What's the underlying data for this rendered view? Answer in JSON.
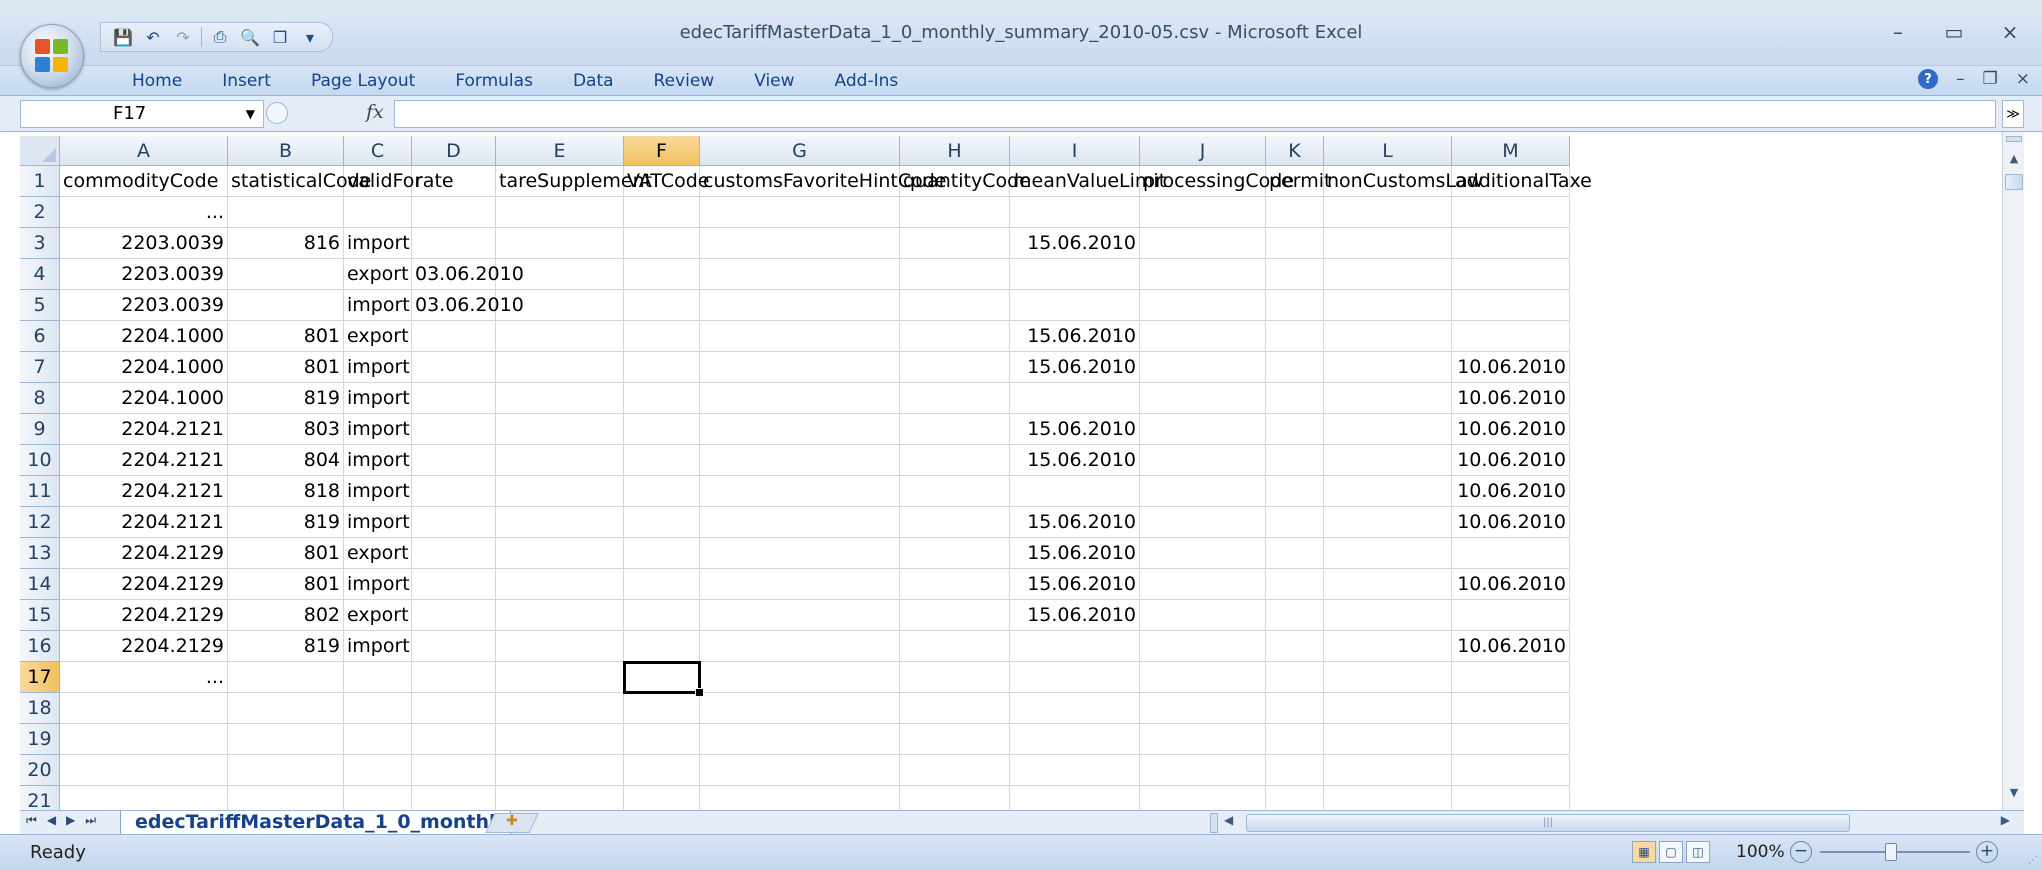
{
  "window": {
    "title": "edecTariffMasterData_1_0_monthly_summary_2010-05.csv - Microsoft Excel",
    "minimize_glyph": "–",
    "maximize_glyph": "▭",
    "close_glyph": "×"
  },
  "quick_access": {
    "icons": [
      "save-icon",
      "undo-icon",
      "redo-icon",
      "print-icon",
      "print-preview-icon",
      "window-icon"
    ],
    "customize_glyph": "▾"
  },
  "ribbon": {
    "tabs": [
      "Home",
      "Insert",
      "Page Layout",
      "Formulas",
      "Data",
      "Review",
      "View",
      "Add-Ins"
    ],
    "help_glyph": "?",
    "doc_min": "–",
    "doc_restore": "❐",
    "doc_close": "×"
  },
  "formula_bar": {
    "name_box": "F17",
    "fx_label": "fx",
    "formula": "",
    "expand_glyph": "≫"
  },
  "sheet": {
    "columns": [
      "A",
      "B",
      "C",
      "D",
      "E",
      "F",
      "G",
      "H",
      "I",
      "J",
      "K",
      "L",
      "M"
    ],
    "active_column": "F",
    "active_row": "17",
    "row_numbers": [
      "1",
      "2",
      "3",
      "4",
      "5",
      "6",
      "7",
      "8",
      "9",
      "10",
      "11",
      "12",
      "13",
      "14",
      "15",
      "16",
      "17",
      "18",
      "19",
      "20",
      "21"
    ],
    "rows": [
      [
        "commodityCode",
        "statisticalCode",
        "validFor",
        "rate",
        "tareSupplement",
        "VATCode",
        "customsFavoriteHintCode",
        "quantityCode",
        "meanValueLimit",
        "processingCode",
        "permit",
        "nonCustomsLaw",
        "additionalTaxe"
      ],
      [
        "...",
        "",
        "",
        "",
        "",
        "",
        "",
        "",
        "",
        "",
        "",
        "",
        ""
      ],
      [
        "2203.0039",
        "816",
        "import",
        "",
        "",
        "",
        "",
        "",
        "15.06.2010",
        "",
        "",
        "",
        ""
      ],
      [
        "2203.0039",
        "",
        "export",
        "03.06.2010",
        "",
        "",
        "",
        "",
        "",
        "",
        "",
        "",
        ""
      ],
      [
        "2203.0039",
        "",
        "import",
        "03.06.2010",
        "",
        "",
        "",
        "",
        "",
        "",
        "",
        "",
        ""
      ],
      [
        "2204.1000",
        "801",
        "export",
        "",
        "",
        "",
        "",
        "",
        "15.06.2010",
        "",
        "",
        "",
        ""
      ],
      [
        "2204.1000",
        "801",
        "import",
        "",
        "",
        "",
        "",
        "",
        "15.06.2010",
        "",
        "",
        "",
        "10.06.2010"
      ],
      [
        "2204.1000",
        "819",
        "import",
        "",
        "",
        "",
        "",
        "",
        "",
        "",
        "",
        "",
        "10.06.2010"
      ],
      [
        "2204.2121",
        "803",
        "import",
        "",
        "",
        "",
        "",
        "",
        "15.06.2010",
        "",
        "",
        "",
        "10.06.2010"
      ],
      [
        "2204.2121",
        "804",
        "import",
        "",
        "",
        "",
        "",
        "",
        "15.06.2010",
        "",
        "",
        "",
        "10.06.2010"
      ],
      [
        "2204.2121",
        "818",
        "import",
        "",
        "",
        "",
        "",
        "",
        "",
        "",
        "",
        "",
        "10.06.2010"
      ],
      [
        "2204.2121",
        "819",
        "import",
        "",
        "",
        "",
        "",
        "",
        "15.06.2010",
        "",
        "",
        "",
        "10.06.2010"
      ],
      [
        "2204.2129",
        "801",
        "export",
        "",
        "",
        "",
        "",
        "",
        "15.06.2010",
        "",
        "",
        "",
        ""
      ],
      [
        "2204.2129",
        "801",
        "import",
        "",
        "",
        "",
        "",
        "",
        "15.06.2010",
        "",
        "",
        "",
        "10.06.2010"
      ],
      [
        "2204.2129",
        "802",
        "export",
        "",
        "",
        "",
        "",
        "",
        "15.06.2010",
        "",
        "",
        "",
        ""
      ],
      [
        "2204.2129",
        "819",
        "import",
        "",
        "",
        "",
        "",
        "",
        "",
        "",
        "",
        "",
        "10.06.2010"
      ],
      [
        "...",
        "",
        "",
        "",
        "",
        "",
        "",
        "",
        "",
        "",
        "",
        "",
        ""
      ],
      [
        "",
        "",
        "",
        "",
        "",
        "",
        "",
        "",
        "",
        "",
        "",
        "",
        ""
      ],
      [
        "",
        "",
        "",
        "",
        "",
        "",
        "",
        "",
        "",
        "",
        "",
        "",
        ""
      ],
      [
        "",
        "",
        "",
        "",
        "",
        "",
        "",
        "",
        "",
        "",
        "",
        "",
        ""
      ],
      [
        "",
        "",
        "",
        "",
        "",
        "",
        "",
        "",
        "",
        "",
        "",
        "",
        ""
      ]
    ]
  },
  "sheet_tabs": {
    "active_tab": "edecTariffMasterData_1_0_monthl",
    "nav_glyphs": [
      "⏮",
      "◀",
      "▶",
      "⏭"
    ]
  },
  "status": {
    "text": "Ready",
    "zoom": "100%",
    "zoom_out_glyph": "−",
    "zoom_in_glyph": "+"
  },
  "colors": {
    "accent": "#15428b",
    "active_header": "#f1c15f"
  }
}
